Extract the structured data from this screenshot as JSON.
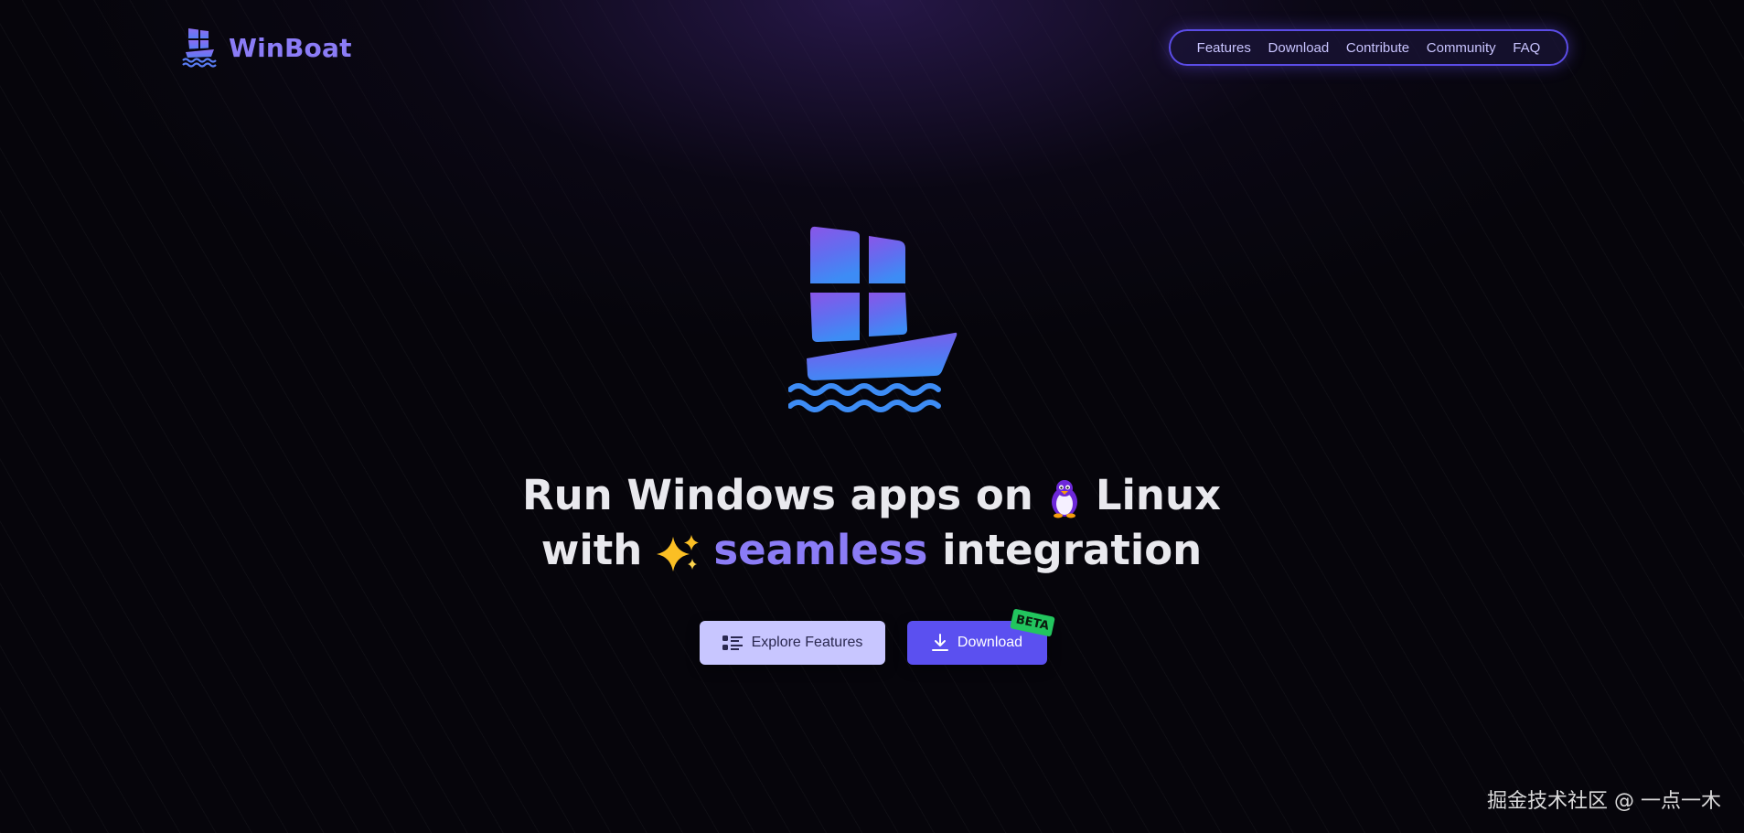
{
  "brand": {
    "name": "WinBoat"
  },
  "nav": {
    "items": [
      "Features",
      "Download",
      "Contribute",
      "Community",
      "FAQ"
    ]
  },
  "hero": {
    "line1_text": "Run Windows apps on",
    "line1_after": "Linux",
    "line2_before": "with",
    "line2_accent": "seamless",
    "line2_after": "integration"
  },
  "buttons": {
    "explore_label": "Explore Features",
    "download_label": "Download",
    "beta_badge": "BETA"
  },
  "icons": {
    "logo": "winboat-logo-icon",
    "penguin": "penguin-icon",
    "sparkles": "sparkles-icon",
    "list": "list-icon",
    "download": "download-icon"
  },
  "colors": {
    "accent": "#8b7cf6",
    "primary_button": "#5b50f0",
    "secondary_button": "#c8c6ff",
    "beta": "#22c55e"
  },
  "watermark": "掘金技术社区 @ 一点一木"
}
